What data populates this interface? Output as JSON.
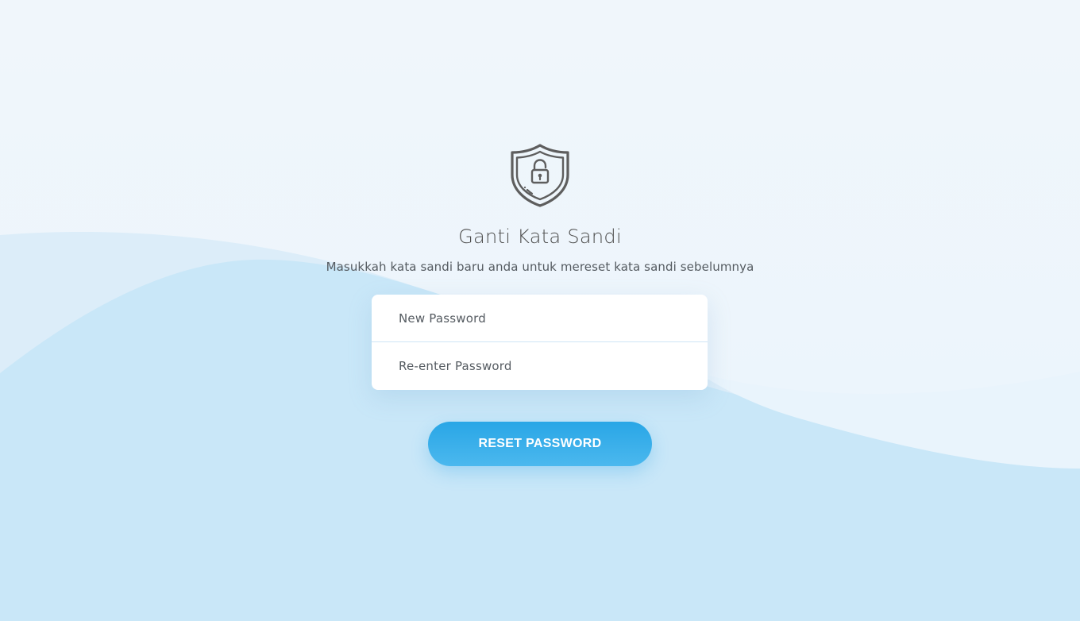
{
  "page": {
    "title": "Ganti Kata Sandi",
    "subtitle": "Masukkah kata sandi baru anda untuk mereset kata sandi sebelumnya"
  },
  "form": {
    "new_password_placeholder": "New Password",
    "reenter_password_placeholder": "Re-enter Password",
    "submit_label": "RESET PASSWORD"
  },
  "icons": {
    "header_icon": "shield-lock-icon"
  },
  "colors": {
    "accent": "#2aa7e6",
    "background_top": "#f0f6fb",
    "wave_light": "#dcedf9",
    "wave_main": "#c9e7f8",
    "text_primary": "#4d4d4d"
  }
}
